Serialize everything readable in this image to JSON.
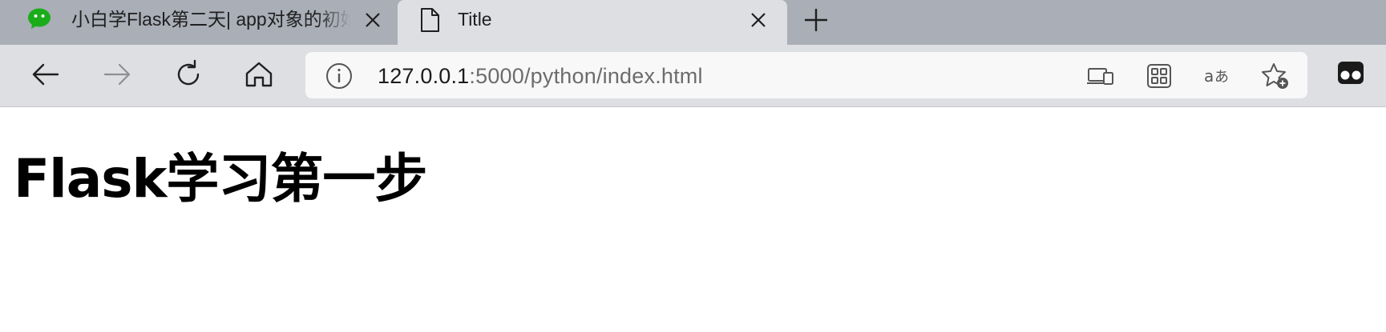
{
  "tabs": [
    {
      "title": "小白学Flask第二天| app对象的初始化和配置",
      "favicon": "wechat-icon",
      "active": false
    },
    {
      "title": "Title",
      "favicon": "document-icon",
      "active": true
    }
  ],
  "toolbar": {
    "icons": [
      "back-icon",
      "forward-icon",
      "refresh-icon",
      "home-icon"
    ]
  },
  "address_bar": {
    "host": "127.0.0.1",
    "path": ":5000/python/index.html",
    "icons": [
      "info-icon",
      "devices-icon",
      "apps-icon",
      "read-aloud-translate-icon",
      "add-favorite-icon"
    ]
  },
  "page": {
    "heading": "Flask学习第一步"
  },
  "colors": {
    "tabstrip": "#a9aeb7",
    "toolbar": "#dedfe3",
    "address_bg": "#f8f8f9",
    "wechat_green": "#1aad19"
  }
}
